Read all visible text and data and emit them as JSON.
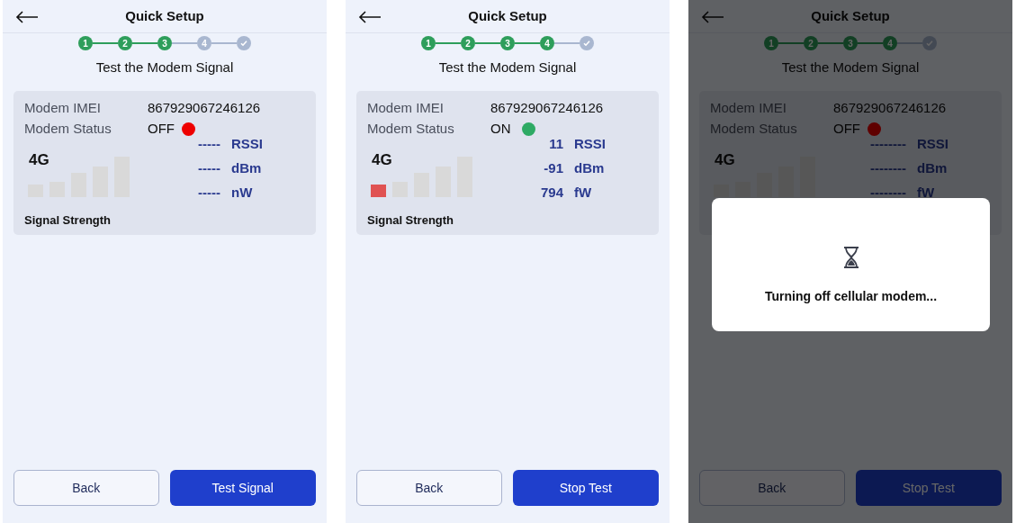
{
  "screens": [
    {
      "title": "Quick Setup",
      "steps": [
        {
          "kind": "number",
          "label": "1",
          "complete": true
        },
        {
          "kind": "number",
          "label": "2",
          "complete": true
        },
        {
          "kind": "number",
          "label": "3",
          "complete": true
        },
        {
          "kind": "number",
          "label": "4",
          "complete": false
        },
        {
          "kind": "check",
          "complete": false
        }
      ],
      "subtitle": "Test the Modem Signal",
      "imei_label": "Modem IMEI",
      "imei": "867929067246126",
      "status_label": "Modem Status",
      "status": {
        "text": "OFF",
        "on": false
      },
      "network": "4G",
      "signal_bars": [
        {
          "lit": false
        },
        {
          "lit": false
        },
        {
          "lit": false
        },
        {
          "lit": false
        },
        {
          "lit": false
        }
      ],
      "readings": [
        {
          "value": "-----",
          "unit": "RSSI"
        },
        {
          "value": "-----",
          "unit": "dBm"
        },
        {
          "value": "-----",
          "unit": "nW"
        }
      ],
      "signal_label": "Signal Strength",
      "back_button": "Back",
      "primary_button": "Test Signal"
    },
    {
      "title": "Quick Setup",
      "steps": [
        {
          "kind": "number",
          "label": "1",
          "complete": true
        },
        {
          "kind": "number",
          "label": "2",
          "complete": true
        },
        {
          "kind": "number",
          "label": "3",
          "complete": true
        },
        {
          "kind": "number",
          "label": "4",
          "complete": true
        },
        {
          "kind": "check",
          "complete": false
        }
      ],
      "subtitle": "Test the Modem Signal",
      "imei_label": "Modem IMEI",
      "imei": "867929067246126",
      "status_label": "Modem Status",
      "status": {
        "text": "ON",
        "on": true
      },
      "network": "4G",
      "signal_bars": [
        {
          "lit": true
        },
        {
          "lit": false
        },
        {
          "lit": false
        },
        {
          "lit": false
        },
        {
          "lit": false
        }
      ],
      "readings": [
        {
          "value": "11",
          "unit": "RSSI"
        },
        {
          "value": "-91",
          "unit": "dBm"
        },
        {
          "value": "794",
          "unit": "fW"
        }
      ],
      "signal_label": "Signal Strength",
      "back_button": "Back",
      "primary_button": "Stop Test"
    },
    {
      "title": "Quick Setup",
      "steps": [
        {
          "kind": "number",
          "label": "1",
          "complete": true
        },
        {
          "kind": "number",
          "label": "2",
          "complete": true
        },
        {
          "kind": "number",
          "label": "3",
          "complete": true
        },
        {
          "kind": "number",
          "label": "4",
          "complete": true
        },
        {
          "kind": "check",
          "complete": false
        }
      ],
      "subtitle": "Test the Modem Signal",
      "imei_label": "Modem IMEI",
      "imei": "867929067246126",
      "status_label": "Modem Status",
      "status": {
        "text": "OFF",
        "on": false
      },
      "network": "4G",
      "signal_bars": [
        {
          "lit": false
        },
        {
          "lit": false
        },
        {
          "lit": false
        },
        {
          "lit": false
        },
        {
          "lit": false
        }
      ],
      "readings": [
        {
          "value": "--------",
          "unit": "RSSI"
        },
        {
          "value": "--------",
          "unit": "dBm"
        },
        {
          "value": "--------",
          "unit": "fW"
        }
      ],
      "back_button": "Back",
      "primary_button": "Stop Test",
      "dialog": {
        "message": "Turning off cellular modem..."
      }
    }
  ]
}
